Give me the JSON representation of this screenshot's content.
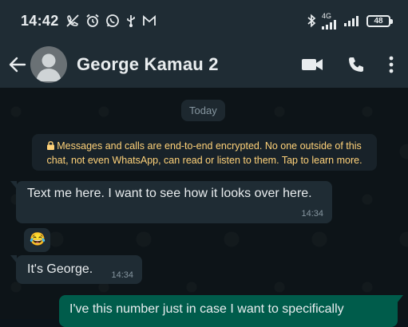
{
  "status_bar": {
    "time": "14:42",
    "network_label": "4G",
    "battery": "48"
  },
  "header": {
    "contact_name": "George Kamau 2"
  },
  "chat": {
    "date_chip": "Today",
    "encryption_notice": "Messages and calls are end-to-end encrypted. No one outside of this chat, not even WhatsApp, can read or listen to them. Tap to learn more.",
    "messages": [
      {
        "direction": "incoming",
        "text": "Text me here. I want to see how it looks over here.",
        "time": "14:34"
      },
      {
        "direction": "incoming",
        "text": "😂",
        "time": ""
      },
      {
        "direction": "incoming",
        "text": "It's George.",
        "time": "14:34"
      },
      {
        "direction": "outgoing",
        "text": "I've this number just in case I want to specifically",
        "time": ""
      }
    ]
  },
  "colors": {
    "app_bar": "#1f2c34",
    "chat_bg": "#0b141a",
    "incoming_bubble": "#1f2c34",
    "outgoing_bubble": "#005c4b",
    "notice_text": "#ffd279"
  },
  "icons": [
    "no-calls-icon",
    "alarm-icon",
    "whatsapp-icon",
    "usb-icon",
    "gmail-icon",
    "bluetooth-icon",
    "signal-icon",
    "battery-icon",
    "back-arrow-icon",
    "avatar-icon",
    "video-call-icon",
    "voice-call-icon",
    "more-vert-icon",
    "lock-icon"
  ]
}
